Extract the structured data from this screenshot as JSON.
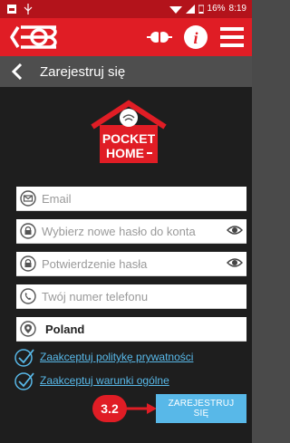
{
  "status_bar": {
    "battery": "16%",
    "time": "8:19"
  },
  "title_bar": {
    "title": "Zarejestruj się"
  },
  "brand": {
    "line1": "POCKET",
    "line2": "HOME"
  },
  "form": {
    "email_placeholder": "Email",
    "password_placeholder": "Wybierz nowe hasło do konta",
    "confirm_placeholder": "Potwierdzenie hasła",
    "phone_placeholder": "Twój numer telefonu",
    "country_value": "Poland"
  },
  "policies": {
    "privacy": "Zaakceptuj politykę prywatności",
    "terms": "Zaakceptuj warunki ogólne"
  },
  "actions": {
    "register_label": "ZAREJESTRUJ SIĘ"
  },
  "annotation": {
    "step": "3.2"
  },
  "colors": {
    "header": "#e01d25",
    "accent": "#58b8e8",
    "background": "#1e1e1e"
  },
  "icons": [
    "image-icon",
    "usb-icon",
    "wifi-icon",
    "signal-icon",
    "battery-icon",
    "logo-icon",
    "plug-icon",
    "info-icon",
    "menu-icon",
    "back-icon",
    "email-icon",
    "lock-icon",
    "eye-icon",
    "phone-icon",
    "location-icon",
    "check-icon",
    "arrow-icon"
  ]
}
